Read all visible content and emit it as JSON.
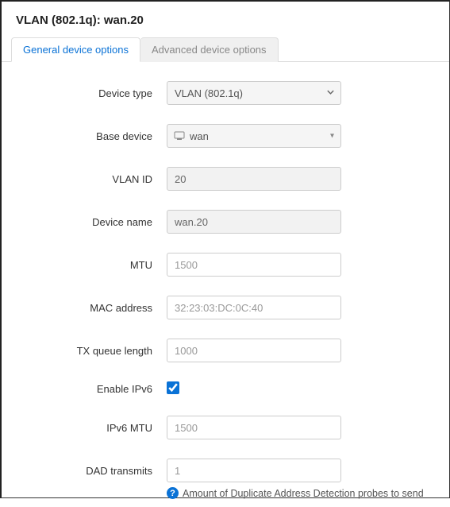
{
  "header": {
    "title": "VLAN (802.1q): wan.20"
  },
  "tabs": {
    "general": "General device options",
    "advanced": "Advanced device options",
    "active": "general"
  },
  "form": {
    "device_type": {
      "label": "Device type",
      "value": "VLAN (802.1q)"
    },
    "base_device": {
      "label": "Base device",
      "value": "wan"
    },
    "vlan_id": {
      "label": "VLAN ID",
      "value": "20"
    },
    "device_name": {
      "label": "Device name",
      "value": "wan.20"
    },
    "mtu": {
      "label": "MTU",
      "placeholder": "1500",
      "value": ""
    },
    "mac": {
      "label": "MAC address",
      "placeholder": "32:23:03:DC:0C:40",
      "value": ""
    },
    "txqueue": {
      "label": "TX queue length",
      "placeholder": "1000",
      "value": ""
    },
    "enable_ipv6": {
      "label": "Enable IPv6",
      "checked": true
    },
    "ipv6_mtu": {
      "label": "IPv6 MTU",
      "placeholder": "1500",
      "value": ""
    },
    "dad": {
      "label": "DAD transmits",
      "placeholder": "1",
      "value": "",
      "hint": "Amount of Duplicate Address Detection probes to send"
    }
  }
}
